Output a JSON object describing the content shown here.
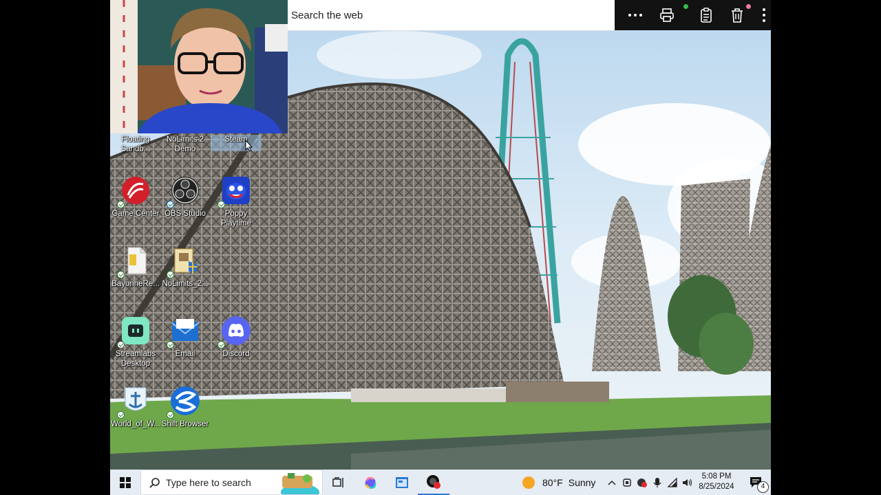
{
  "browser": {
    "search_placeholder": "Search the web",
    "toolbar_icons": [
      "more-icon",
      "print-icon",
      "clipboard-icon",
      "trash-icon",
      "kebab-menu-icon"
    ]
  },
  "desktop": {
    "icons_row0": [
      {
        "label": "Floating Sandb...",
        "name": "floating-sandbox"
      },
      {
        "label": "NoLimits 2 Demo",
        "name": "nolimits-2-demo"
      },
      {
        "label": "Steam",
        "name": "steam"
      }
    ],
    "icons": [
      {
        "label": "Game Center",
        "name": "game-center"
      },
      {
        "label": "OBS Studio",
        "name": "obs-studio"
      },
      {
        "label": "Poppy Playtime",
        "name": "poppy-playtime"
      },
      {
        "label": "BayonneRe...",
        "name": "bayonnere"
      },
      {
        "label": "NoLimits_2...",
        "name": "nolimits-2-installer"
      },
      {
        "label": "Streamlabs Desktop",
        "name": "streamlabs-desktop"
      },
      {
        "label": "Email",
        "name": "email"
      },
      {
        "label": "Discord",
        "name": "discord"
      },
      {
        "label": "World_of_W...",
        "name": "world-of-warships"
      },
      {
        "label": "Shift Browser",
        "name": "shift-browser"
      }
    ]
  },
  "taskbar": {
    "search_placeholder": "Type here to search",
    "weather_temp": "80°F",
    "weather_cond": "Sunny",
    "time": "5:08 PM",
    "date": "8/25/2024",
    "notification_count": "4"
  },
  "colors": {
    "taskbar_bg": "#e6ecf3",
    "browser_toolbar_bg": "#121212",
    "sky": "#cfe3f2",
    "grass": "#6fa84a"
  }
}
